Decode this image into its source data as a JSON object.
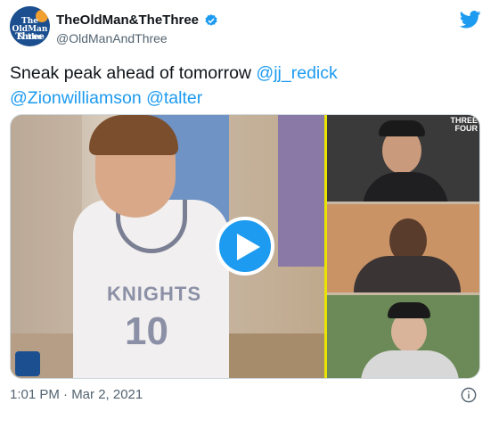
{
  "account": {
    "display_name": "TheOldMan&TheThree",
    "handle": "@OldManAndThree",
    "avatar_line1": "The OldMan & the",
    "avatar_line2": "Three"
  },
  "tweet": {
    "text_prefix": "Sneak peak ahead of tomorrow ",
    "mentions": [
      "@jj_redick",
      "@Zionwilliamson",
      "@talter"
    ]
  },
  "media": {
    "jersey_word": "KNIGHTS",
    "jersey_number": "10",
    "brand_line1": "THREE",
    "brand_line2": "FOUR"
  },
  "meta": {
    "timestamp": "1:01 PM · Mar 2, 2021"
  },
  "colors": {
    "accent": "#1d9bf0",
    "divider": "#e8e400"
  },
  "icons": {
    "verified": "verified-badge-icon",
    "logo": "twitter-bird-icon",
    "play": "play-icon",
    "info": "info-icon"
  }
}
